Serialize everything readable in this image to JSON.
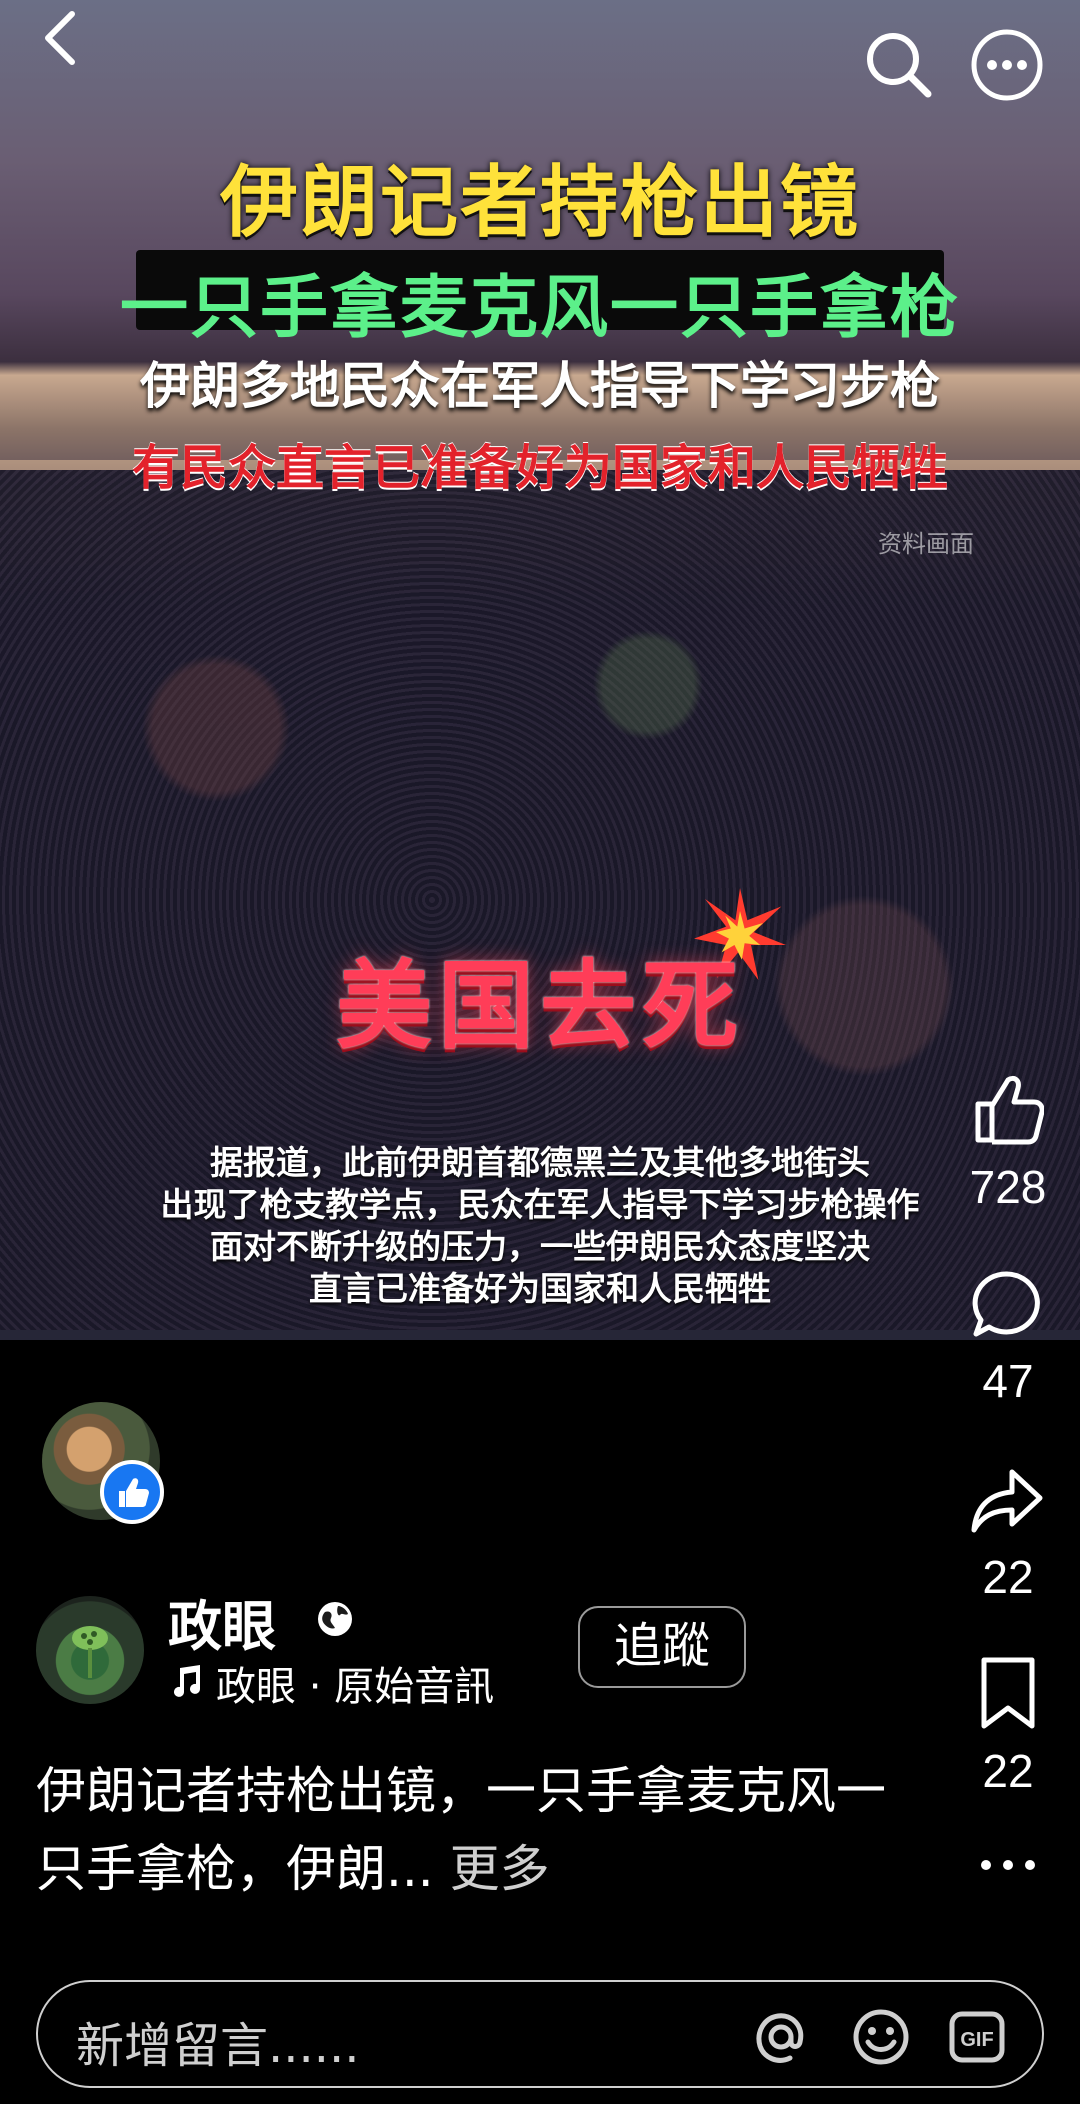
{
  "video": {
    "title_line1": "伊朗记者持枪出镜",
    "title_line2": "一只手拿麦克风一只手拿枪",
    "title_line3": "伊朗多地民众在军人指导下学习步枪",
    "title_line4": "有民众直言已准备好为国家和人民牺牲",
    "watermark": "资料画面",
    "slogan": "美国去死",
    "caption_lines": [
      "据报道，此前伊朗首都德黑兰及其他多地街头",
      "出现了枪支教学点，民众在军人指导下学习步枪操作",
      "面对不断升级的压力，一些伊朗民众态度坚决",
      "直言已准备好为国家和人民牺牲"
    ]
  },
  "top_bar": {
    "back_icon": "chevron-left-icon",
    "search_icon": "search-icon",
    "more_icon": "more-horizontal-icon"
  },
  "actions": {
    "likes": "728",
    "comments": "47",
    "shares": "22",
    "saves": "22"
  },
  "channel": {
    "name": "政眼",
    "audio": "政眼 · 原始音訊",
    "follow_label": "追蹤"
  },
  "description": {
    "text": "伊朗记者持枪出镜，一只手拿麦克风一只手拿枪，伊朗...",
    "more_label": "更多"
  },
  "comment_input": {
    "placeholder": "新增留言......"
  },
  "colors": {
    "accent_blue": "#1877f2",
    "title_yellow": "#ffe23a",
    "title_green": "#5cf08a",
    "title_red": "#e3222b"
  }
}
